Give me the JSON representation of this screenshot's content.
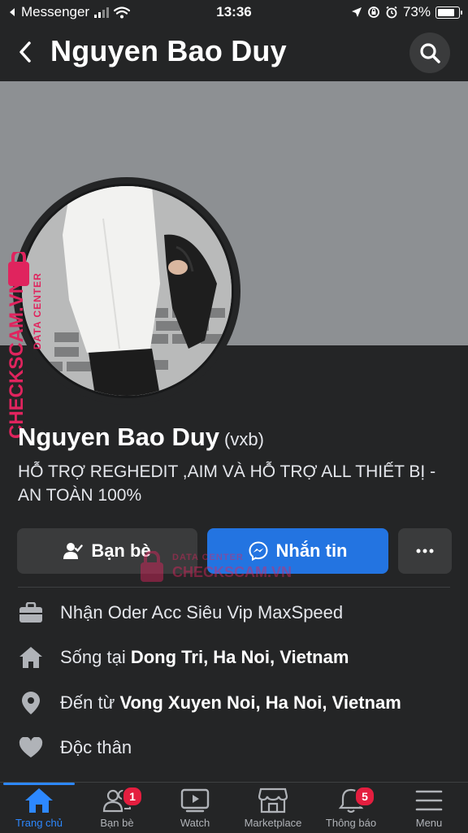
{
  "status_bar": {
    "back_app": "Messenger",
    "time": "13:36",
    "battery": "73%"
  },
  "header": {
    "title": "Nguyen Bao Duy"
  },
  "profile": {
    "name": "Nguyen Bao Duy",
    "alternate_name": "(vxb)",
    "bio": "HỖ TRỢ REGHEDIT ,AIM VÀ HỖ TRỢ ALL THIẾT BỊ - AN TOÀN 100%"
  },
  "actions": {
    "friends_label": "Bạn bè",
    "message_label": "Nhắn tin"
  },
  "details": {
    "work": "Nhận Oder Acc Siêu Vip MaxSpeed",
    "lives_prefix": "Sống tại",
    "lives_place": "Dong Tri, Ha Noi, Vietnam",
    "from_prefix": "Đến từ",
    "from_place": "Vong Xuyen Noi, Ha Noi, Vietnam",
    "relationship": "Độc thân"
  },
  "watermark": {
    "line1": "DATA CENTER",
    "line2": "CHECKSCAM.VN"
  },
  "tabs": [
    {
      "label": "Trang chủ",
      "icon": "home-icon",
      "active": true
    },
    {
      "label": "Bạn bè",
      "icon": "friends-icon",
      "badge": "1"
    },
    {
      "label": "Watch",
      "icon": "watch-icon"
    },
    {
      "label": "Marketplace",
      "icon": "marketplace-icon"
    },
    {
      "label": "Thông báo",
      "icon": "bell-icon",
      "badge": "5"
    },
    {
      "label": "Menu",
      "icon": "menu-icon"
    }
  ],
  "colors": {
    "background": "#242526",
    "cover": "#8d9093",
    "accent": "#2374e1",
    "badge": "#e41e3f",
    "watermark": "#e0245e"
  }
}
